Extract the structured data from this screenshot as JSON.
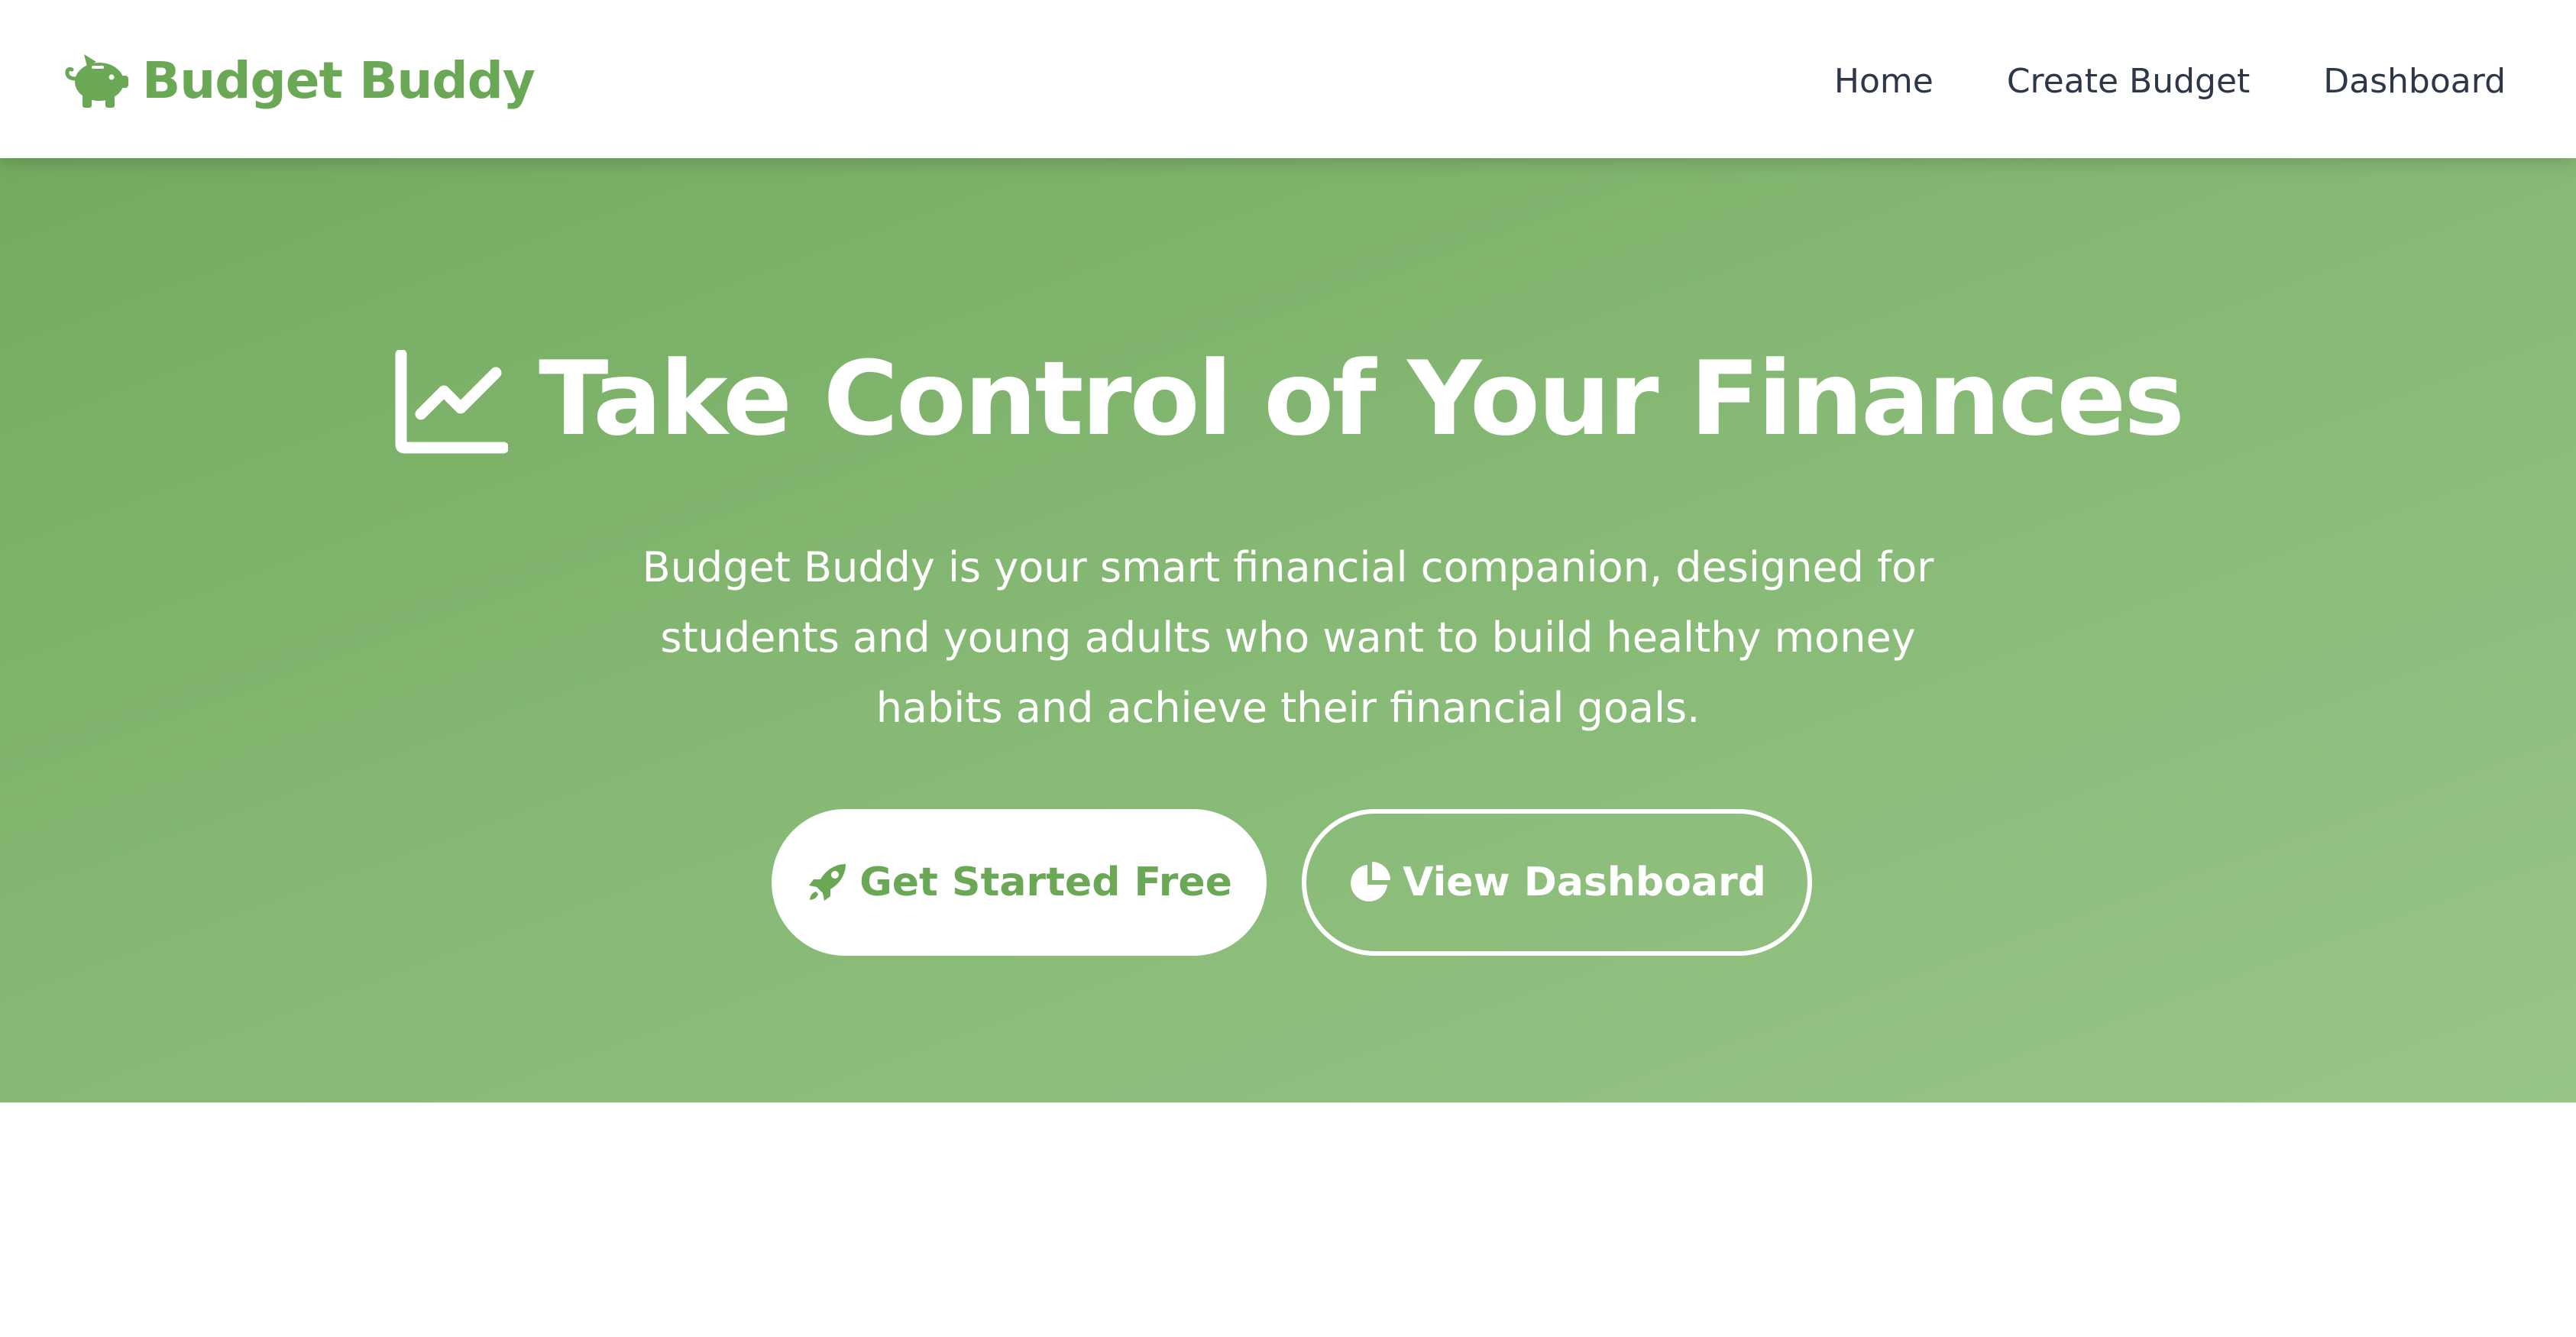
{
  "navbar": {
    "brand": {
      "icon": "piggy-bank-icon",
      "name": "Budget Buddy"
    },
    "links": [
      {
        "label": "Home"
      },
      {
        "label": "Create Budget"
      },
      {
        "label": "Dashboard"
      }
    ]
  },
  "hero": {
    "icon": "chart-line-icon",
    "title": "Take Control of Your Finances",
    "description": "Budget Buddy is your smart financial companion, designed for students and young adults who want to build healthy money habits and achieve their financial goals.",
    "primary_button": {
      "icon": "rocket-icon",
      "label": "Get Started Free"
    },
    "secondary_button": {
      "icon": "chart-pie-icon",
      "label": "View Dashboard"
    }
  },
  "colors": {
    "brand_green": "#6aa856",
    "hero_gradient_start": "#73aa5f",
    "hero_gradient_end": "#97c588",
    "nav_text": "#2d3748"
  }
}
